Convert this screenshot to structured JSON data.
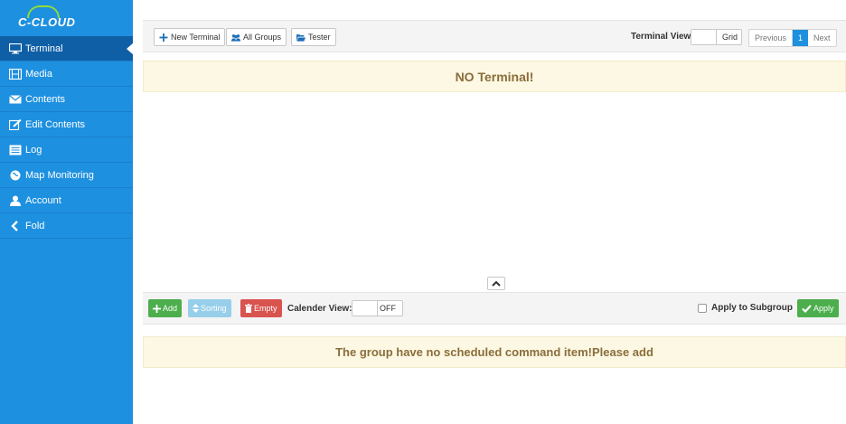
{
  "brand": {
    "name": "C-CLOUD"
  },
  "sidebar": {
    "items": [
      {
        "label": "Terminal",
        "icon": "monitor-icon",
        "active": true
      },
      {
        "label": "Media",
        "icon": "film-icon"
      },
      {
        "label": "Contents",
        "icon": "envelope-icon"
      },
      {
        "label": "Edit Contents",
        "icon": "edit-icon"
      },
      {
        "label": "Log",
        "icon": "list-icon"
      },
      {
        "label": "Map Monitoring",
        "icon": "globe-icon"
      },
      {
        "label": "Account",
        "icon": "user-icon"
      },
      {
        "label": "Fold",
        "icon": "chevron-left-icon"
      }
    ]
  },
  "toolbar": {
    "new_terminal": "New Terminal",
    "all_groups": "All Groups",
    "tester": "Tester",
    "terminal_view_label": "Terminal View:",
    "terminal_view_value": "Grid",
    "pager": {
      "previous": "Previous",
      "current": "1",
      "next": "Next"
    }
  },
  "notices": {
    "no_terminal": "NO Terminal!",
    "no_schedule": "The group have no scheduled command item!Please add"
  },
  "schedule_bar": {
    "add": "Add",
    "sorting": "Sorting",
    "empty": "Empty",
    "calendar_view_label": "Calender View:",
    "calendar_view_value": "OFF",
    "apply_subgroup_label": "Apply to Subgroup",
    "apply": "Apply"
  },
  "colors": {
    "sidebar": "#1e90e0",
    "sidebar_active": "#0e5fa6",
    "notice_bg": "#fcf8e3",
    "notice_text": "#8a6d3b",
    "success": "#4cae4c",
    "danger": "#d9534f",
    "info_light": "#97cfea"
  }
}
